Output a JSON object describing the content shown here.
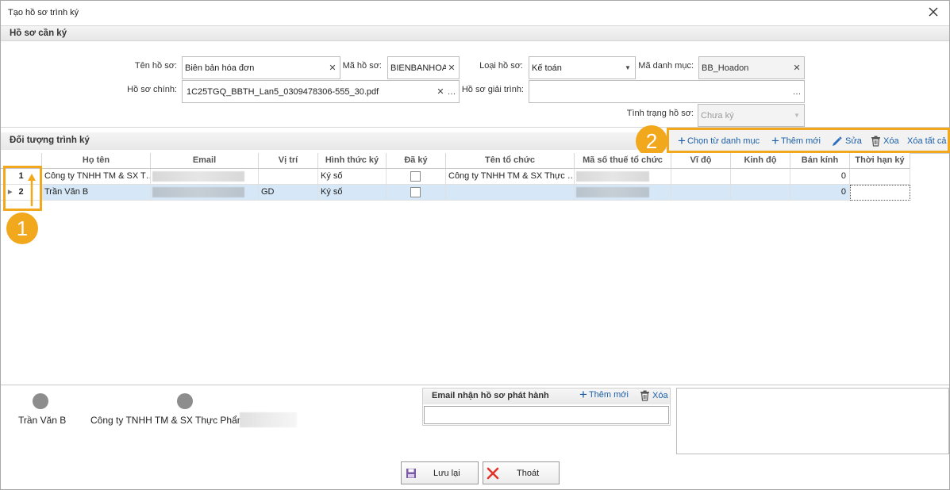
{
  "window": {
    "title": "Tạo hồ sơ trình ký"
  },
  "ho_so_section": {
    "title": "Hồ sơ cần ký"
  },
  "form": {
    "ten_ho_so": {
      "label": "Tên hồ sơ:",
      "value": "Biên bản hóa đơn"
    },
    "ma_ho_so": {
      "label": "Mã hồ sơ:",
      "value": "BIENBANHOAD"
    },
    "loai_ho_so": {
      "label": "Loại hồ sơ:",
      "value": "Kế toán"
    },
    "ma_danh_muc": {
      "label": "Mã danh mục:",
      "value": "BB_Hoadon"
    },
    "ho_so_chinh": {
      "label": "Hồ sơ chính:",
      "value": "1C25TGQ_BBTH_Lan5_0309478306-555_30.pdf"
    },
    "ho_so_giai_trinh": {
      "label": "Hồ sơ giải trình:",
      "value": ""
    },
    "tinh_trang": {
      "label": "Tình trạng hồ sơ:",
      "value": "Chưa ký"
    }
  },
  "doi_tuong_section": {
    "title": "Đối tượng trình ký"
  },
  "toolbar": {
    "chon_tu_danh_muc": "Chọn từ danh mục",
    "them_moi": "Thêm mới",
    "sua": "Sửa",
    "xoa": "Xóa",
    "xoa_tat_ca": "Xóa tất cả"
  },
  "grid": {
    "columns": [
      "Họ tên",
      "Email",
      "Vị trí",
      "Hình thức ký",
      "Đã ký",
      "Tên tổ chức",
      "Mã số thuế tổ chức",
      "Vĩ độ",
      "Kinh độ",
      "Bán kính",
      "Thời hạn ký"
    ],
    "rows": [
      {
        "num": "1",
        "ho_ten": "Công ty TNHH TM & SX T…",
        "email": "",
        "vi_tri": "",
        "hinh_thuc": "Ký số",
        "da_ky": false,
        "to_chuc": "Công ty TNHH TM & SX Thực …",
        "mst": "",
        "vi_do": "",
        "kinh_do": "",
        "ban_kinh": "0",
        "thoi_han": ""
      },
      {
        "num": "2",
        "ho_ten": "Trần Văn B",
        "email": "",
        "vi_tri": "GD",
        "hinh_thuc": "Ký số",
        "da_ky": false,
        "to_chuc": "",
        "mst": "",
        "vi_do": "",
        "kinh_do": "",
        "ban_kinh": "0",
        "thoi_han": ""
      }
    ]
  },
  "annotations": {
    "badge1": "1",
    "badge2": "2",
    "accent": "#f2a81d"
  },
  "signers": [
    {
      "name": "Trần Văn B"
    },
    {
      "name": "Công ty TNHH TM & SX Thực Phẩm"
    }
  ],
  "email_panel": {
    "title": "Email nhận hồ sơ phát hành",
    "them_moi": "Thêm mới",
    "xoa": "Xóa",
    "input_value": ""
  },
  "footer": {
    "save_label": "Lưu lại",
    "exit_label": "Thoát"
  }
}
